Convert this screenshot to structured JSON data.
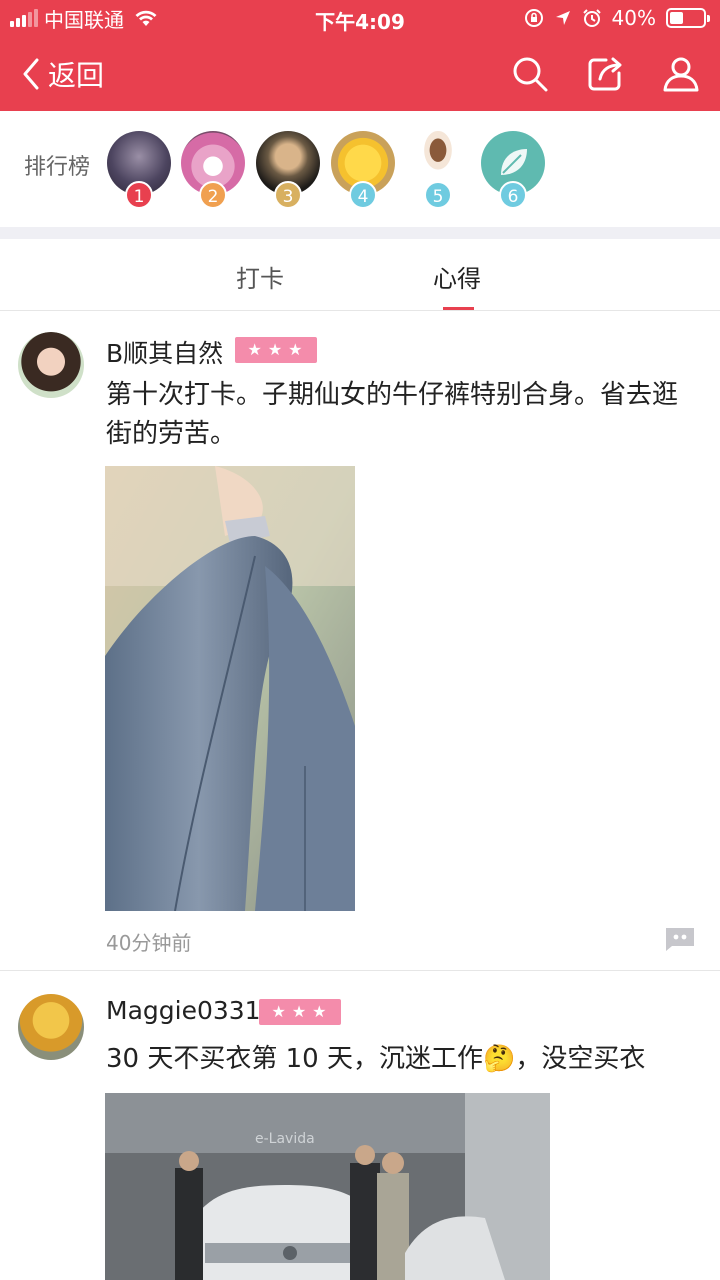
{
  "status_bar": {
    "carrier": "中国联通",
    "time": "下午4:09",
    "battery_percent": "40%",
    "battery_level": 0.4
  },
  "nav": {
    "back_label": "返回",
    "icons": [
      "search-icon",
      "share-icon",
      "user-icon"
    ]
  },
  "ranking": {
    "title": "排行榜",
    "items": [
      {
        "rank": "1",
        "badge_color": "#e8404f"
      },
      {
        "rank": "2",
        "badge_color": "#f0a050"
      },
      {
        "rank": "3",
        "badge_color": "#d8b060"
      },
      {
        "rank": "4",
        "badge_color": "#6fcbe0"
      },
      {
        "rank": "5",
        "badge_color": "#6fcbe0"
      },
      {
        "rank": "6",
        "badge_color": "#6fcbe0"
      }
    ]
  },
  "tabs": [
    {
      "label": "打卡",
      "active": false
    },
    {
      "label": "心得",
      "active": true
    }
  ],
  "posts": [
    {
      "author": "B顺其自然",
      "stars": "★★★",
      "text": "第十次打卡。子期仙女的牛仔裤特别合身。省去逛街的劳苦。",
      "time": "40分钟前"
    },
    {
      "author": "Maggie0331",
      "stars": "★★★",
      "text": "30 天不买衣第 10 天，沉迷工作🤔，没空买衣",
      "image_caption": "e-Lavida"
    }
  ],
  "colors": {
    "accent": "#e8404f",
    "star_badge": "#f48cab",
    "separator": "#efeff4"
  }
}
